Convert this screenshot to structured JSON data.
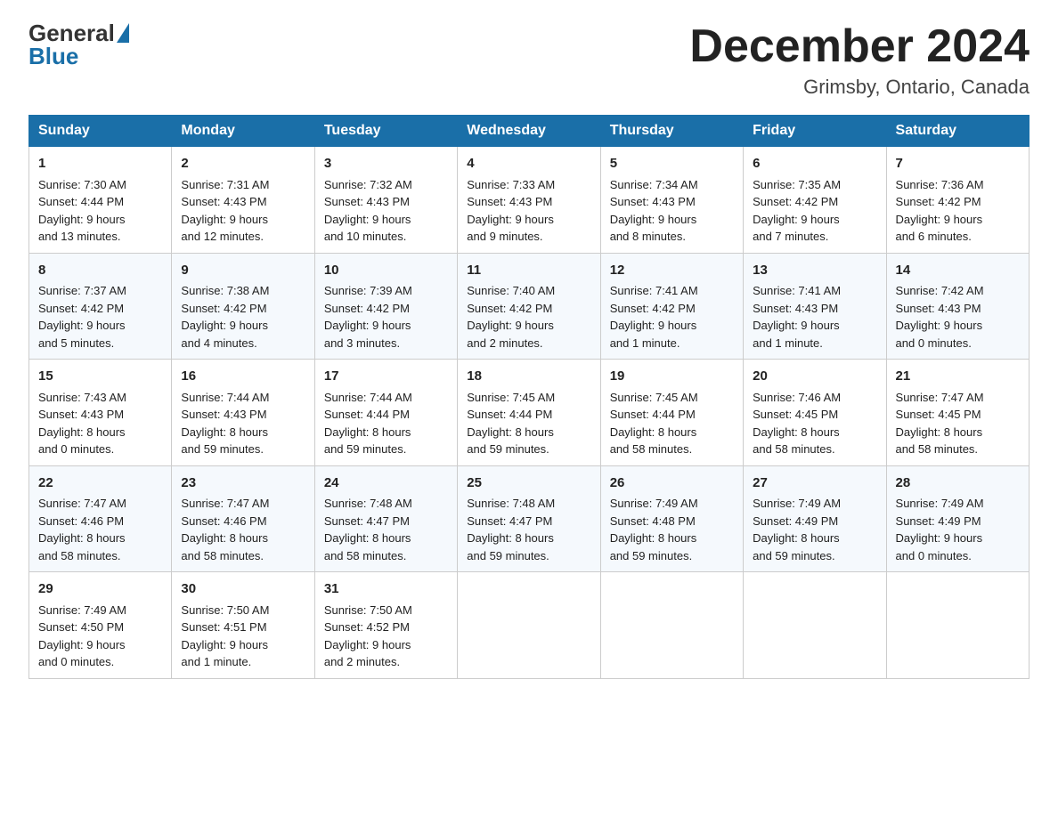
{
  "header": {
    "logo_general": "General",
    "logo_blue": "Blue",
    "month_title": "December 2024",
    "location": "Grimsby, Ontario, Canada"
  },
  "days_of_week": [
    "Sunday",
    "Monday",
    "Tuesday",
    "Wednesday",
    "Thursday",
    "Friday",
    "Saturday"
  ],
  "weeks": [
    [
      {
        "day": "1",
        "sunrise": "7:30 AM",
        "sunset": "4:44 PM",
        "daylight": "9 hours and 13 minutes."
      },
      {
        "day": "2",
        "sunrise": "7:31 AM",
        "sunset": "4:43 PM",
        "daylight": "9 hours and 12 minutes."
      },
      {
        "day": "3",
        "sunrise": "7:32 AM",
        "sunset": "4:43 PM",
        "daylight": "9 hours and 10 minutes."
      },
      {
        "day": "4",
        "sunrise": "7:33 AM",
        "sunset": "4:43 PM",
        "daylight": "9 hours and 9 minutes."
      },
      {
        "day": "5",
        "sunrise": "7:34 AM",
        "sunset": "4:43 PM",
        "daylight": "9 hours and 8 minutes."
      },
      {
        "day": "6",
        "sunrise": "7:35 AM",
        "sunset": "4:42 PM",
        "daylight": "9 hours and 7 minutes."
      },
      {
        "day": "7",
        "sunrise": "7:36 AM",
        "sunset": "4:42 PM",
        "daylight": "9 hours and 6 minutes."
      }
    ],
    [
      {
        "day": "8",
        "sunrise": "7:37 AM",
        "sunset": "4:42 PM",
        "daylight": "9 hours and 5 minutes."
      },
      {
        "day": "9",
        "sunrise": "7:38 AM",
        "sunset": "4:42 PM",
        "daylight": "9 hours and 4 minutes."
      },
      {
        "day": "10",
        "sunrise": "7:39 AM",
        "sunset": "4:42 PM",
        "daylight": "9 hours and 3 minutes."
      },
      {
        "day": "11",
        "sunrise": "7:40 AM",
        "sunset": "4:42 PM",
        "daylight": "9 hours and 2 minutes."
      },
      {
        "day": "12",
        "sunrise": "7:41 AM",
        "sunset": "4:42 PM",
        "daylight": "9 hours and 1 minute."
      },
      {
        "day": "13",
        "sunrise": "7:41 AM",
        "sunset": "4:43 PM",
        "daylight": "9 hours and 1 minute."
      },
      {
        "day": "14",
        "sunrise": "7:42 AM",
        "sunset": "4:43 PM",
        "daylight": "9 hours and 0 minutes."
      }
    ],
    [
      {
        "day": "15",
        "sunrise": "7:43 AM",
        "sunset": "4:43 PM",
        "daylight": "8 hours and 0 minutes."
      },
      {
        "day": "16",
        "sunrise": "7:44 AM",
        "sunset": "4:43 PM",
        "daylight": "8 hours and 59 minutes."
      },
      {
        "day": "17",
        "sunrise": "7:44 AM",
        "sunset": "4:44 PM",
        "daylight": "8 hours and 59 minutes."
      },
      {
        "day": "18",
        "sunrise": "7:45 AM",
        "sunset": "4:44 PM",
        "daylight": "8 hours and 59 minutes."
      },
      {
        "day": "19",
        "sunrise": "7:45 AM",
        "sunset": "4:44 PM",
        "daylight": "8 hours and 58 minutes."
      },
      {
        "day": "20",
        "sunrise": "7:46 AM",
        "sunset": "4:45 PM",
        "daylight": "8 hours and 58 minutes."
      },
      {
        "day": "21",
        "sunrise": "7:47 AM",
        "sunset": "4:45 PM",
        "daylight": "8 hours and 58 minutes."
      }
    ],
    [
      {
        "day": "22",
        "sunrise": "7:47 AM",
        "sunset": "4:46 PM",
        "daylight": "8 hours and 58 minutes."
      },
      {
        "day": "23",
        "sunrise": "7:47 AM",
        "sunset": "4:46 PM",
        "daylight": "8 hours and 58 minutes."
      },
      {
        "day": "24",
        "sunrise": "7:48 AM",
        "sunset": "4:47 PM",
        "daylight": "8 hours and 58 minutes."
      },
      {
        "day": "25",
        "sunrise": "7:48 AM",
        "sunset": "4:47 PM",
        "daylight": "8 hours and 59 minutes."
      },
      {
        "day": "26",
        "sunrise": "7:49 AM",
        "sunset": "4:48 PM",
        "daylight": "8 hours and 59 minutes."
      },
      {
        "day": "27",
        "sunrise": "7:49 AM",
        "sunset": "4:49 PM",
        "daylight": "8 hours and 59 minutes."
      },
      {
        "day": "28",
        "sunrise": "7:49 AM",
        "sunset": "4:49 PM",
        "daylight": "9 hours and 0 minutes."
      }
    ],
    [
      {
        "day": "29",
        "sunrise": "7:49 AM",
        "sunset": "4:50 PM",
        "daylight": "9 hours and 0 minutes."
      },
      {
        "day": "30",
        "sunrise": "7:50 AM",
        "sunset": "4:51 PM",
        "daylight": "9 hours and 1 minute."
      },
      {
        "day": "31",
        "sunrise": "7:50 AM",
        "sunset": "4:52 PM",
        "daylight": "9 hours and 2 minutes."
      },
      null,
      null,
      null,
      null
    ]
  ],
  "labels": {
    "sunrise": "Sunrise:",
    "sunset": "Sunset:",
    "daylight": "Daylight:"
  }
}
